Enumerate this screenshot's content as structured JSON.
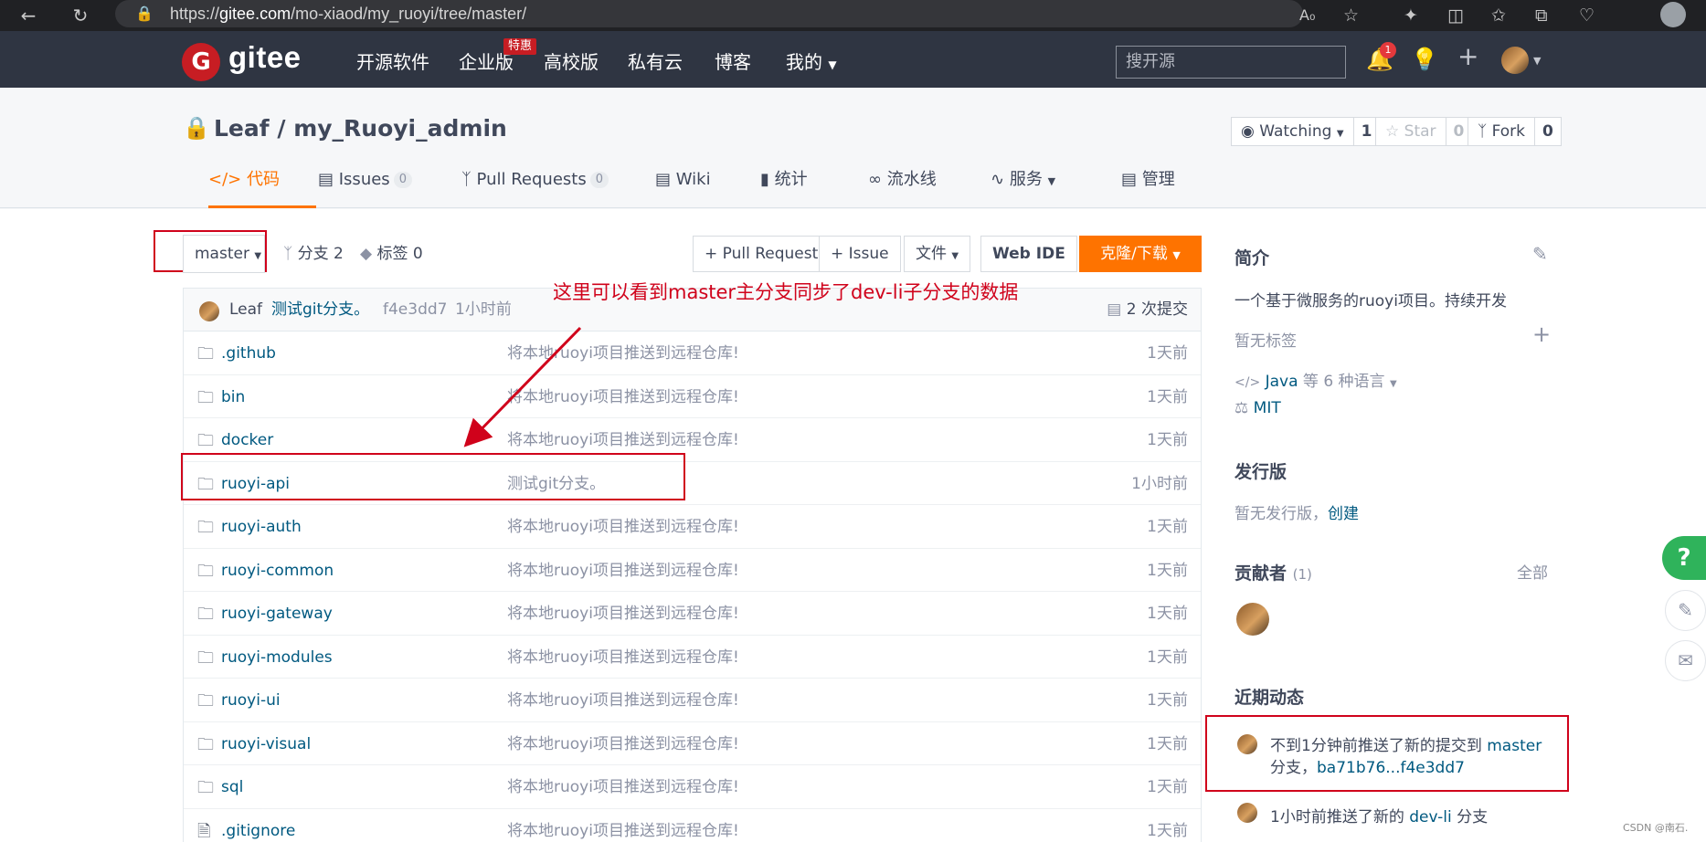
{
  "browser": {
    "url_prefix": "https://",
    "url_host": "gitee.com",
    "url_path": "/mo-xiaod/my_ruoyi/tree/master/",
    "icons": [
      "back-icon",
      "refresh-icon",
      "lock-icon",
      "read-aloud-icon",
      "favorite-icon",
      "extensions-icon",
      "split-screen-icon",
      "favorites-icon",
      "collections-icon",
      "health-icon",
      "profile-icon"
    ]
  },
  "header": {
    "logo": "gitee",
    "nav": [
      "开源软件",
      "企业版",
      "高校版",
      "私有云",
      "博客",
      "我的"
    ],
    "enterprise_badge": "特惠",
    "search_placeholder": "搜开源",
    "notification_count": "1"
  },
  "repo": {
    "owner": "Leaf",
    "separator": " / ",
    "name": "my_Ruoyi_admin",
    "watch_label": "Watching",
    "watch_count": "1",
    "star_label": "Star",
    "star_count": "0",
    "fork_label": "Fork",
    "fork_count": "0",
    "tabs": [
      {
        "label": "代码",
        "active": true
      },
      {
        "label": "Issues",
        "count": "0"
      },
      {
        "label": "Pull Requests",
        "count": "0"
      },
      {
        "label": "Wiki"
      },
      {
        "label": "统计"
      },
      {
        "label": "流水线"
      },
      {
        "label": "服务"
      },
      {
        "label": "管理"
      }
    ]
  },
  "toolbar": {
    "branch": "master",
    "branches": "分支 2",
    "tags": "标签 0",
    "pull_request": "+ Pull Request",
    "issue": "+ Issue",
    "files": "文件",
    "web_ide": "Web IDE",
    "clone": "克隆/下载"
  },
  "commit": {
    "author": "Leaf",
    "message": "测试git分支。",
    "hash": "f4e3dd7",
    "time": "1小时前",
    "commits": "2 次提交"
  },
  "files": [
    {
      "name": ".github",
      "type": "folder",
      "message": "将本地ruoyi项目推送到远程仓库!",
      "time": "1天前"
    },
    {
      "name": "bin",
      "type": "folder",
      "message": "将本地ruoyi项目推送到远程仓库!",
      "time": "1天前"
    },
    {
      "name": "docker",
      "type": "folder",
      "message": "将本地ruoyi项目推送到远程仓库!",
      "time": "1天前"
    },
    {
      "name": "ruoyi-api",
      "type": "folder",
      "message": "测试git分支。",
      "time": "1小时前"
    },
    {
      "name": "ruoyi-auth",
      "type": "folder",
      "message": "将本地ruoyi项目推送到远程仓库!",
      "time": "1天前"
    },
    {
      "name": "ruoyi-common",
      "type": "folder",
      "message": "将本地ruoyi项目推送到远程仓库!",
      "time": "1天前"
    },
    {
      "name": "ruoyi-gateway",
      "type": "folder",
      "message": "将本地ruoyi项目推送到远程仓库!",
      "time": "1天前"
    },
    {
      "name": "ruoyi-modules",
      "type": "folder",
      "message": "将本地ruoyi项目推送到远程仓库!",
      "time": "1天前"
    },
    {
      "name": "ruoyi-ui",
      "type": "folder",
      "message": "将本地ruoyi项目推送到远程仓库!",
      "time": "1天前"
    },
    {
      "name": "ruoyi-visual",
      "type": "folder",
      "message": "将本地ruoyi项目推送到远程仓库!",
      "time": "1天前"
    },
    {
      "name": "sql",
      "type": "folder",
      "message": "将本地ruoyi项目推送到远程仓库!",
      "time": "1天前"
    },
    {
      "name": ".gitignore",
      "type": "file",
      "message": "将本地ruoyi项目推送到远程仓库!",
      "time": "1天前"
    }
  ],
  "annotation": "这里可以看到master主分支同步了dev-li子分支的数据",
  "sidebar": {
    "intro_title": "简介",
    "intro_text": "一个基于微服务的ruoyi项目。持续开发",
    "no_tags": "暂无标签",
    "language_name": "Java",
    "language_suffix": " 等 6 种语言",
    "license": "MIT",
    "release_title": "发行版",
    "release_text": "暂无发行版，",
    "release_link": "创建",
    "contrib_title": "贡献者",
    "contrib_count": "(1)",
    "contrib_all": "全部",
    "activity_title": "近期动态",
    "act1_pre": "不到1分钟前推送了新的提交到 ",
    "act1_branch": "master",
    "act1_mid": "分支，",
    "act1_range": "ba71b76...f4e3dd7",
    "act2_pre": "1小时前推送了新的 ",
    "act2_branch": "dev-li",
    "act2_post": " 分支"
  },
  "float": {
    "help": "?"
  },
  "watermark": "CSDN @南石."
}
